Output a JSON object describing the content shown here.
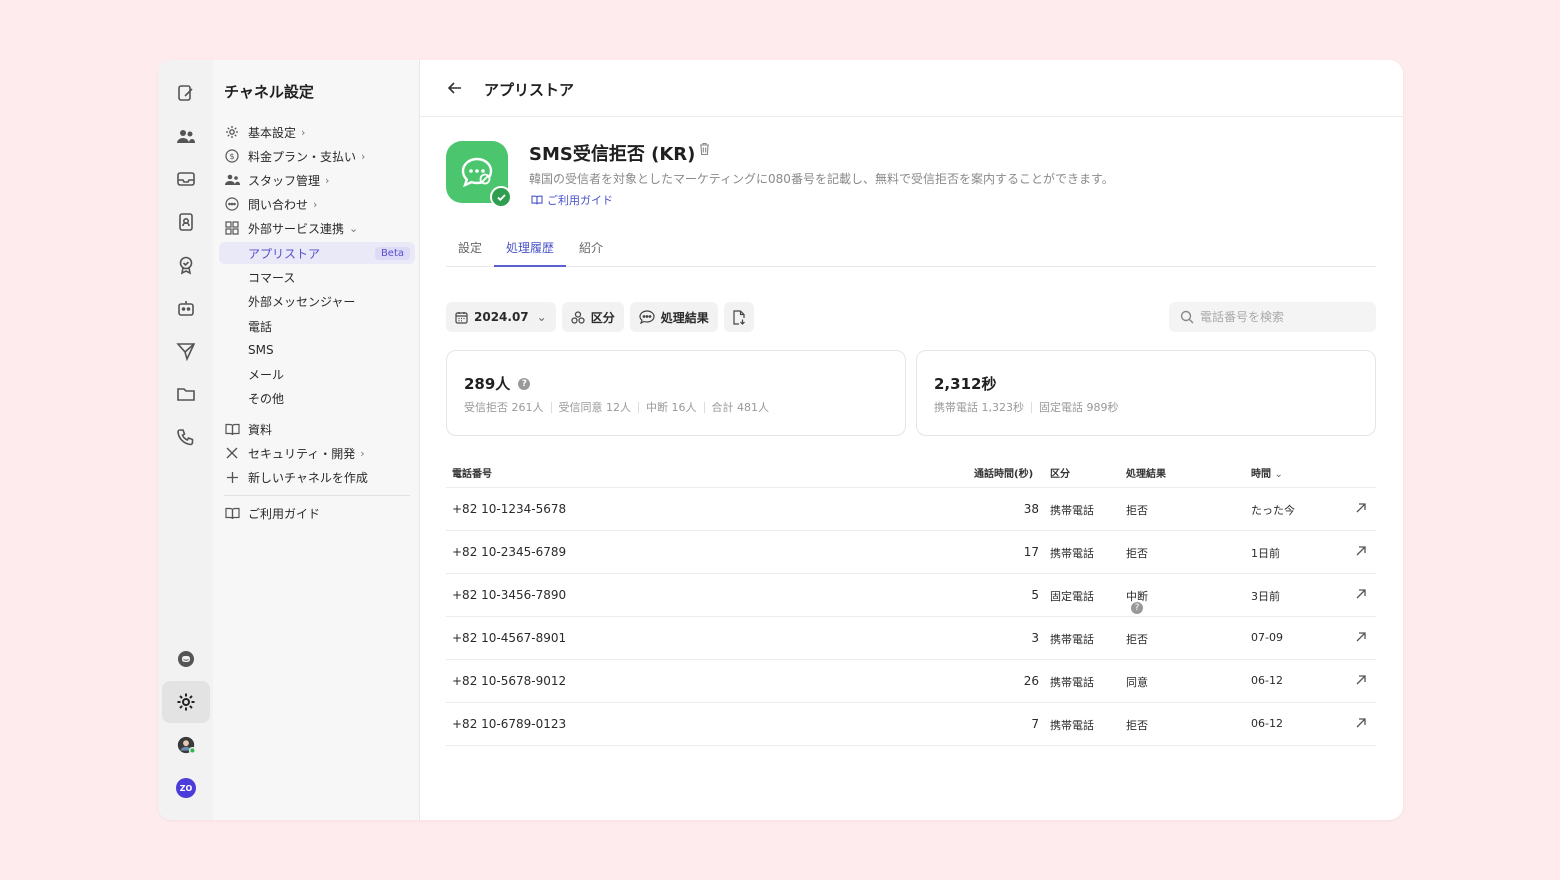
{
  "sidebar": {
    "title": "チャネル設定",
    "items": [
      {
        "label": "基本設定"
      },
      {
        "label": "料金プラン・支払い"
      },
      {
        "label": "スタッフ管理"
      },
      {
        "label": "問い合わせ"
      },
      {
        "label": "外部サービス連携"
      }
    ],
    "subitems": [
      {
        "label": "アプリストア",
        "badge": "Beta"
      },
      {
        "label": "コマース"
      },
      {
        "label": "外部メッセンジャー"
      },
      {
        "label": "電話"
      },
      {
        "label": "SMS"
      },
      {
        "label": "メール"
      },
      {
        "label": "その他"
      }
    ],
    "lower": [
      {
        "label": "資料"
      },
      {
        "label": "セキュリティ・開発"
      },
      {
        "label": "新しいチャネルを作成"
      }
    ],
    "guide": "ご利用ガイド",
    "rail_avatar_text": "ZO"
  },
  "header": {
    "title": "アプリストア"
  },
  "app": {
    "name": "SMS受信拒否 (KR)",
    "description": "韓国の受信者を対象としたマーケティングに080番号を記載し、無料で受信拒否を案内することができます。",
    "guide_link": "ご利用ガイド"
  },
  "tabs": [
    {
      "label": "設定"
    },
    {
      "label": "処理履歴"
    },
    {
      "label": "紹介"
    }
  ],
  "toolbar": {
    "date": "2024.07",
    "category": "区分",
    "result": "処理結果",
    "search_placeholder": "電話番号を検索"
  },
  "stats": {
    "people": {
      "total": "289人",
      "breakdown": [
        "受信拒否 261人",
        "受信同意 12人",
        "中断 16人",
        "合計 481人"
      ]
    },
    "seconds": {
      "total": "2,312秒",
      "breakdown": [
        "携帯電話 1,323秒",
        "固定電話 989秒"
      ]
    }
  },
  "table": {
    "headers": {
      "phone": "電話番号",
      "duration": "通話時間(秒)",
      "type": "区分",
      "result": "処理結果",
      "time": "時間"
    },
    "rows": [
      {
        "phone": "+82 10-1234-5678",
        "duration": "38",
        "type": "携帯電話",
        "result": "拒否",
        "time": "たった今"
      },
      {
        "phone": "+82 10-2345-6789",
        "duration": "17",
        "type": "携帯電話",
        "result": "拒否",
        "time": "1日前"
      },
      {
        "phone": "+82 10-3456-7890",
        "duration": "5",
        "type": "固定電話",
        "result": "中断",
        "time": "3日前"
      },
      {
        "phone": "+82 10-4567-8901",
        "duration": "3",
        "type": "携帯電話",
        "result": "拒否",
        "time": "07-09"
      },
      {
        "phone": "+82 10-5678-9012",
        "duration": "26",
        "type": "携帯電話",
        "result": "同意",
        "time": "06-12"
      },
      {
        "phone": "+82 10-6789-0123",
        "duration": "7",
        "type": "携帯電話",
        "result": "拒否",
        "time": "06-12"
      }
    ]
  },
  "colors": {
    "accent": "#5a4fcf",
    "app_green": "#4cc56f",
    "background": "#fdebee"
  }
}
